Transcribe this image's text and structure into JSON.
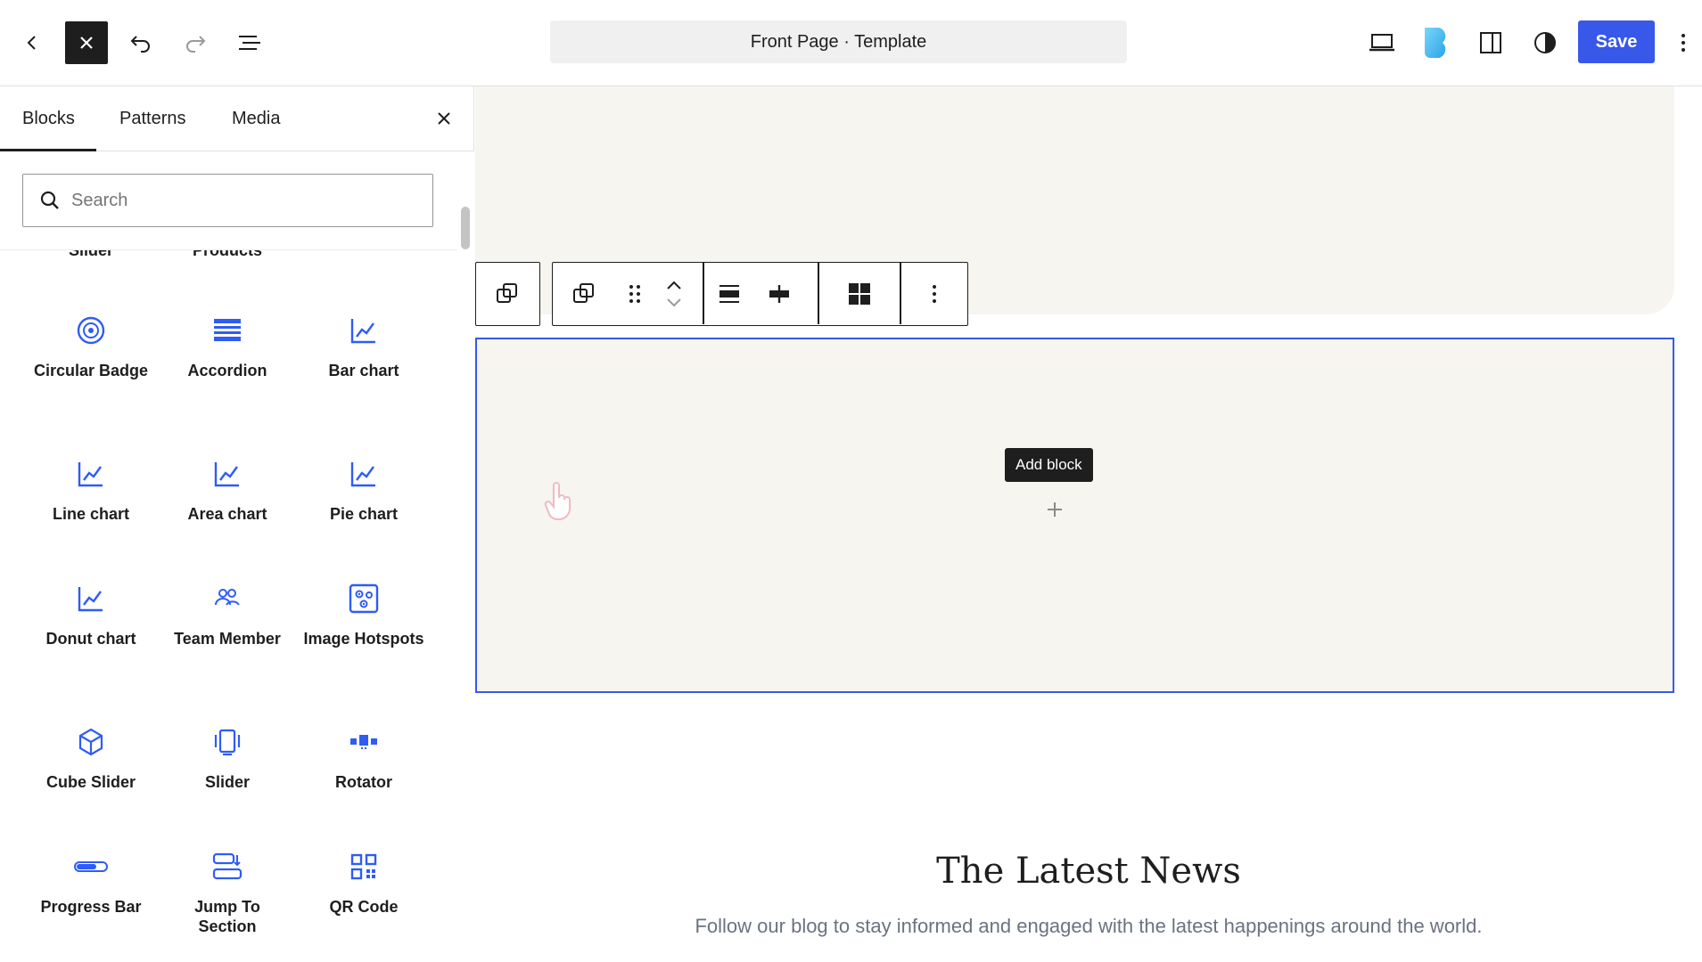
{
  "header": {
    "document_title": "Front Page · Template",
    "save_label": "Save"
  },
  "inserter": {
    "tabs": [
      {
        "label": "Blocks",
        "active": true
      },
      {
        "label": "Patterns",
        "active": false
      },
      {
        "label": "Media",
        "active": false
      }
    ],
    "search": {
      "placeholder": "Search",
      "value": ""
    },
    "cut_labels": [
      "Slider",
      "Products"
    ],
    "blocks": [
      {
        "label": "Circular Badge",
        "icon": "circular-badge-icon"
      },
      {
        "label": "Accordion",
        "icon": "accordion-icon"
      },
      {
        "label": "Bar chart",
        "icon": "chart-line-icon"
      },
      {
        "label": "Line chart",
        "icon": "chart-line-icon"
      },
      {
        "label": "Area chart",
        "icon": "chart-line-icon"
      },
      {
        "label": "Pie chart",
        "icon": "chart-line-icon"
      },
      {
        "label": "Donut chart",
        "icon": "chart-line-icon"
      },
      {
        "label": "Team Member",
        "icon": "team-member-icon"
      },
      {
        "label": "Image Hotspots",
        "icon": "image-hotspots-icon"
      },
      {
        "label": "Cube Slider",
        "icon": "cube-icon"
      },
      {
        "label": "Slider",
        "icon": "slider-icon"
      },
      {
        "label": "Rotator",
        "icon": "rotator-icon"
      },
      {
        "label": "Progress Bar",
        "icon": "progress-bar-icon"
      },
      {
        "label": "Jump To Section",
        "icon": "jump-to-section-icon"
      },
      {
        "label": "QR Code",
        "icon": "qr-code-icon"
      }
    ]
  },
  "canvas": {
    "tooltip": "Add block",
    "news_title": "The Latest News",
    "news_subtitle": "Follow our blog to stay informed and engaged with the latest happenings around the world."
  },
  "colors": {
    "accent": "#3858e9",
    "canvas_bg": "#f6f5f0",
    "block_icon": "#2f5cf5",
    "brand_gradient": [
      "#6fd0f7",
      "#2aa4e8"
    ]
  }
}
